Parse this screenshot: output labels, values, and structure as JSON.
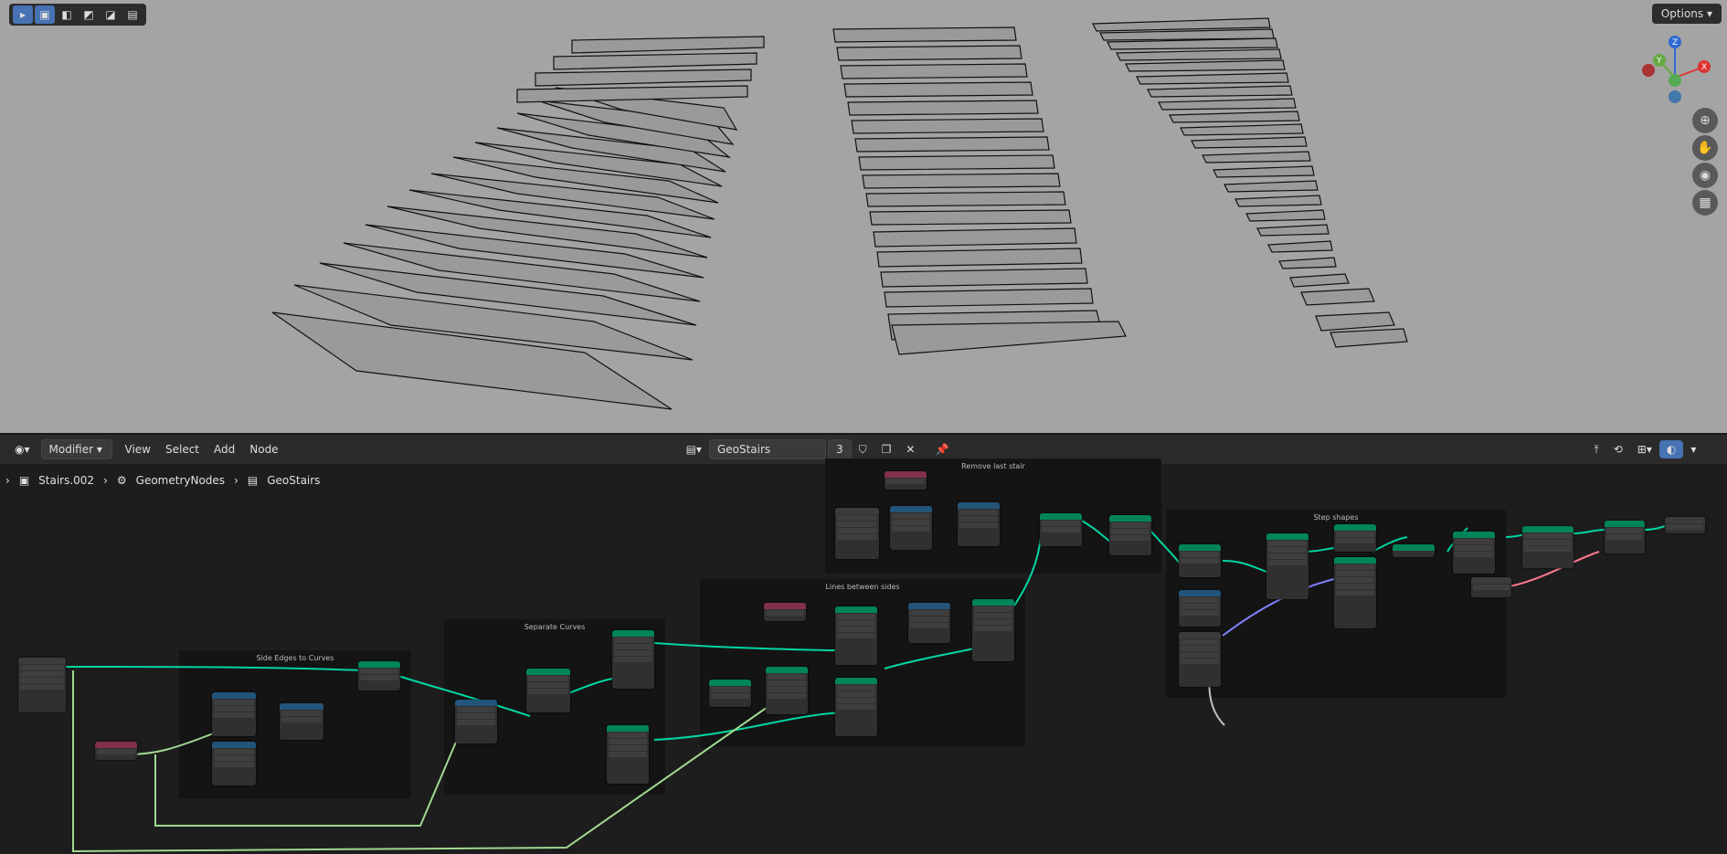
{
  "viewport": {
    "options_label": "Options",
    "gizmo": {
      "z": "Z",
      "y": "Y",
      "x": "X"
    },
    "tools": [
      "cursor-icon",
      "select-box-icon",
      "select-extend-icon",
      "select-subtract-icon",
      "select-invert-icon",
      "select-intersect-icon"
    ]
  },
  "header": {
    "editor_type_icon": "node-editor-icon",
    "mode": "Modifier",
    "menus": [
      "View",
      "Select",
      "Add",
      "Node"
    ],
    "tree_name": "GeoStairs",
    "users": "3"
  },
  "breadcrumb": [
    "Stairs.002",
    "GeometryNodes",
    "GeoStairs"
  ],
  "frames": {
    "side_edges": "Side Edges to Curves",
    "separate": "Separate Curves",
    "lines": "Lines between sides",
    "remove": "Remove last stair",
    "step": "Step shapes"
  },
  "colors": {
    "geometry": "#00845a",
    "function": "#23547a",
    "input": "#83314a",
    "link_geometry": "#00d6a3",
    "link_field": "#b0e0a0"
  }
}
